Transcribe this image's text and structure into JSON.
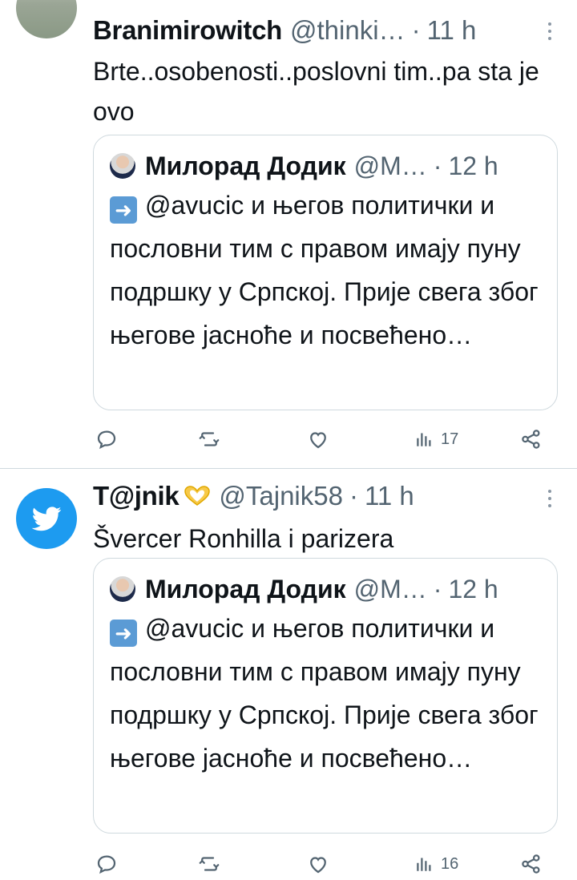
{
  "tweets": [
    {
      "author": "Branimirowitch",
      "handle": "@thinki…",
      "time": "11 h",
      "text": "Brte..osobenosti..poslovni tim..pa sta je ovo",
      "quote": {
        "author": "Милорад Додик",
        "handle": "@M…",
        "time": "12 h",
        "text": "@avucic и његов политички и пословни тим с правом имају пуну подршку у Српској. Прије свега због његове јасноће и посвећено…"
      },
      "views": "17"
    },
    {
      "author": "T@jnik",
      "handle": "@Tajnik58",
      "time": "11 h",
      "text": "Švercer Ronhilla i parizera",
      "quote": {
        "author": "Милорад Додик",
        "handle": "@M…",
        "time": "12 h",
        "text": "@avucic и његов политички и пословни тим с правом имају пуну подршку у Српској. Прије свега због његове јасноће и посвећено…"
      },
      "views": "16"
    }
  ],
  "separator": "·",
  "colors": {
    "accent": "#1d9bf0",
    "muted": "#536471",
    "border": "#cfd9de"
  },
  "icons": [
    "reply-icon",
    "retweet-icon",
    "like-icon",
    "views-icon",
    "share-icon",
    "more-icon",
    "right-arrow-emoji",
    "twitter-bird-icon",
    "heart-hands-emoji"
  ]
}
